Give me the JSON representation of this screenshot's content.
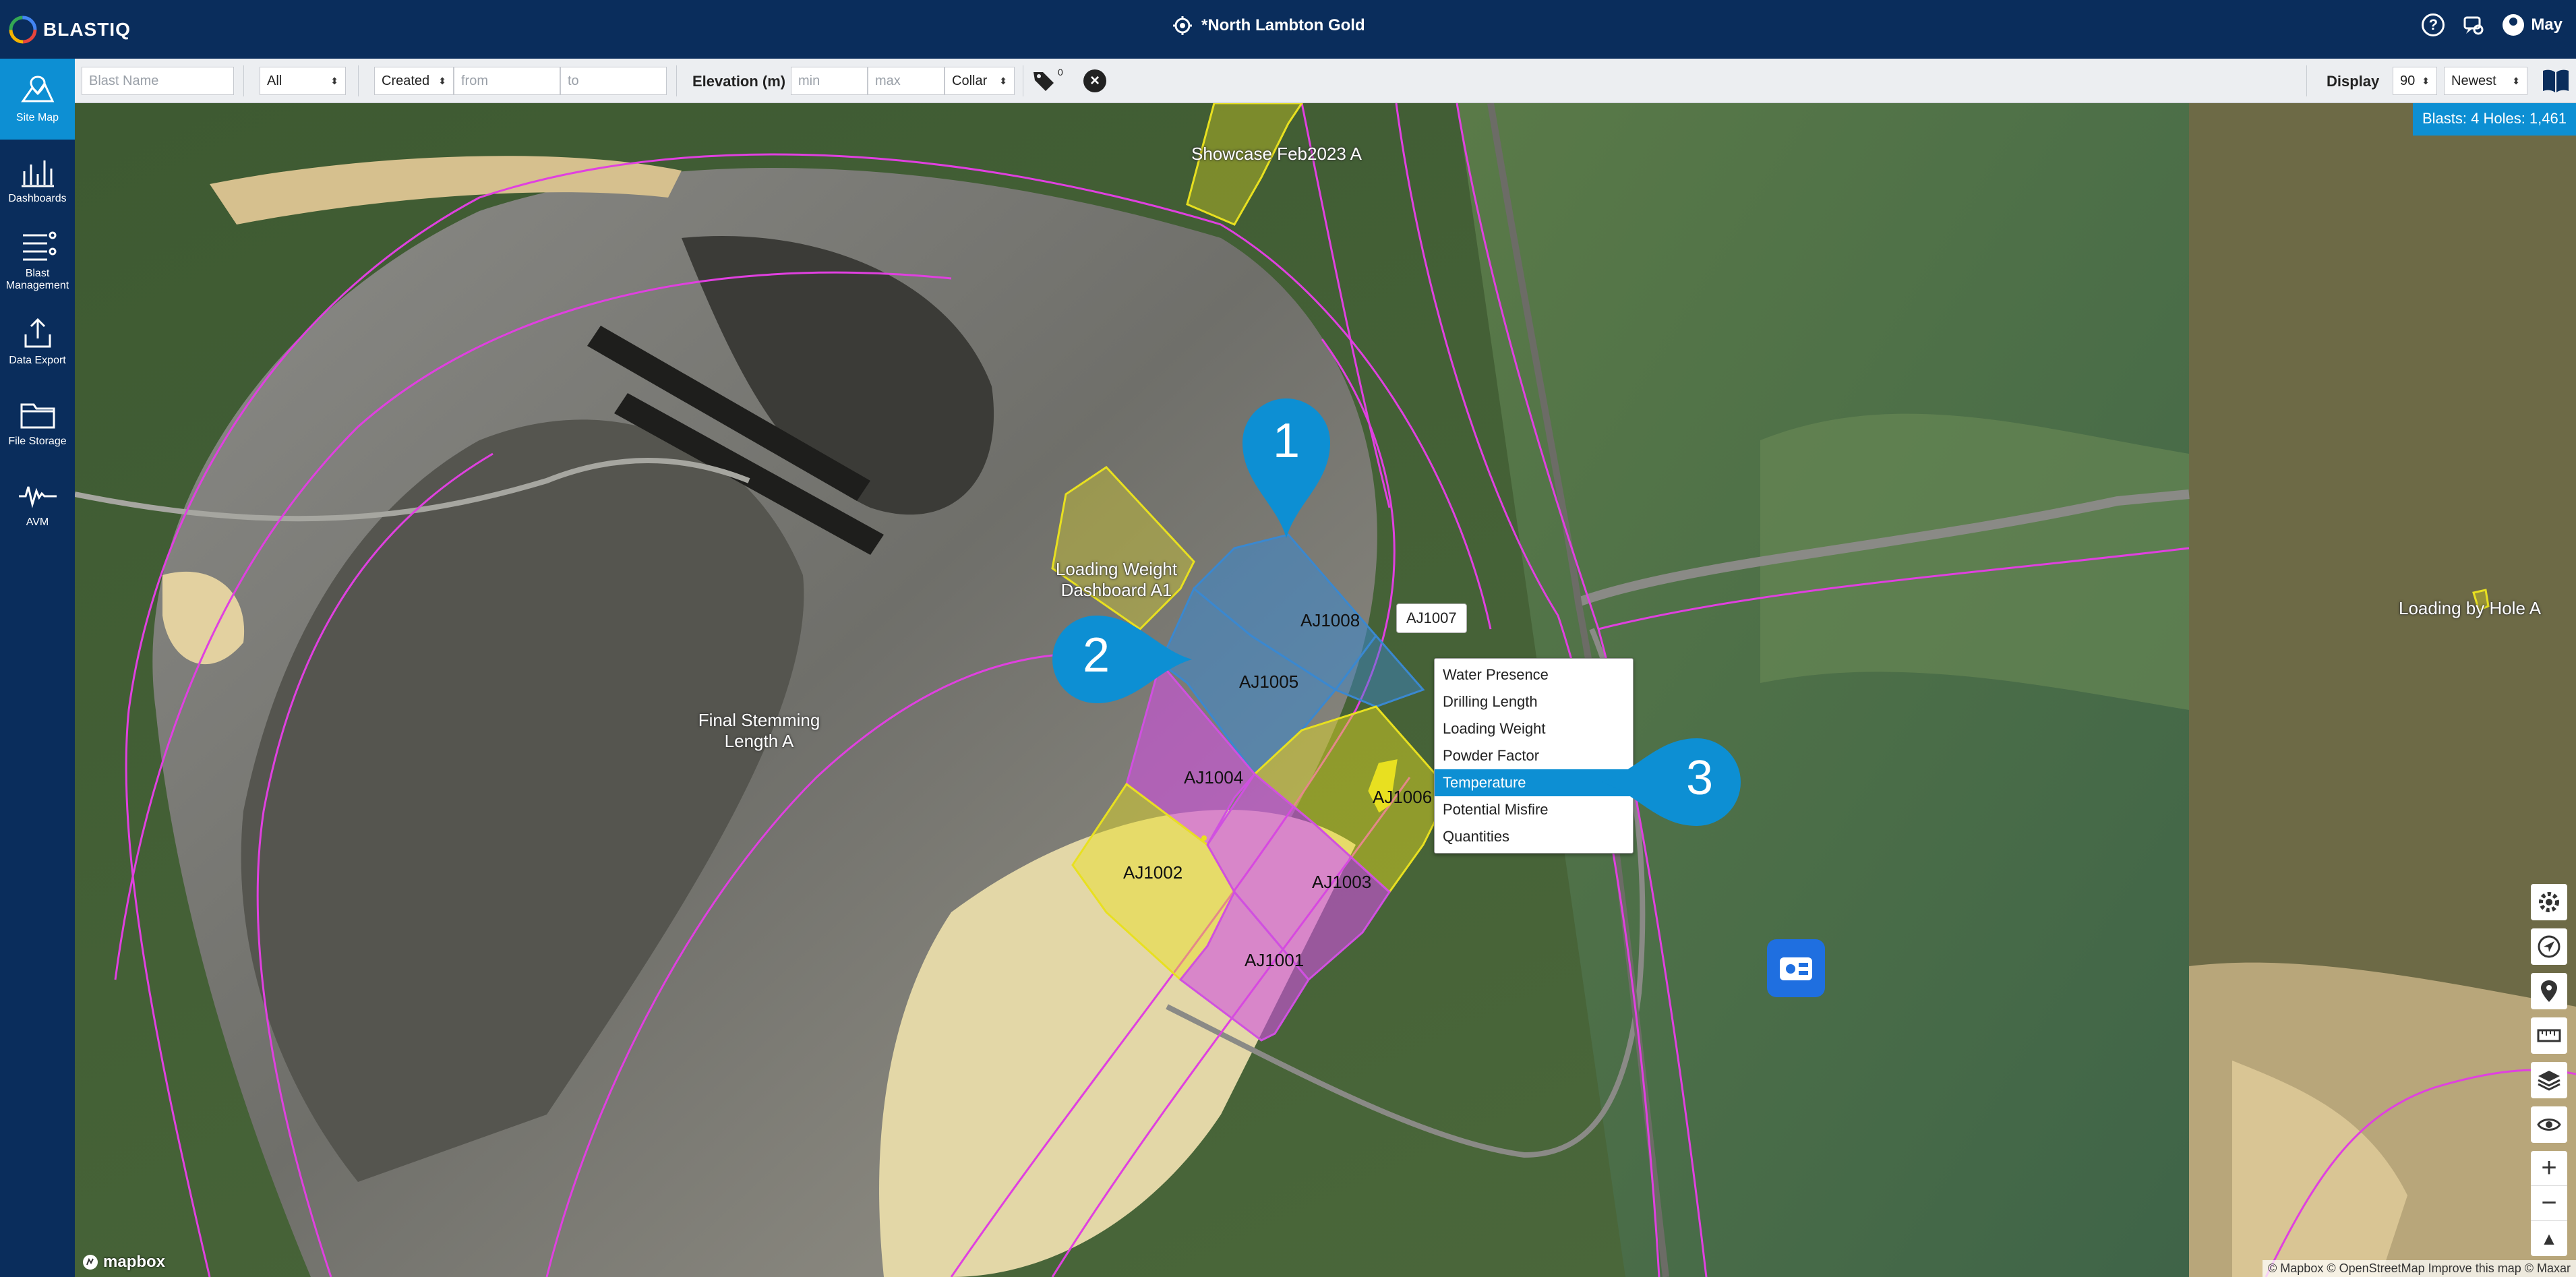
{
  "app": {
    "name": "BLASTIQ",
    "site": "*North Lambton Gold",
    "user": "May"
  },
  "sidebar": {
    "items": [
      {
        "label": "Site Map",
        "icon": "map-icon",
        "active": true
      },
      {
        "label": "Dashboards",
        "icon": "dashboard-icon"
      },
      {
        "label": "Blast Management",
        "icon": "list-icon"
      },
      {
        "label": "Data Export",
        "icon": "export-icon"
      },
      {
        "label": "File Storage",
        "icon": "folder-icon"
      },
      {
        "label": "AVM",
        "icon": "waveform-icon"
      }
    ]
  },
  "filters": {
    "blast_name_placeholder": "Blast Name",
    "type_value": "All",
    "date_field": "Created",
    "from_placeholder": "from",
    "to_placeholder": "to",
    "elevation_label": "Elevation (m)",
    "min_placeholder": "min",
    "max_placeholder": "max",
    "elevation_type": "Collar",
    "tag_count": "0",
    "display_label": "Display",
    "display_count": "90",
    "sort": "Newest"
  },
  "map": {
    "summary": "Blasts: 4 Holes: 1,461",
    "blast_labels": [
      "Showcase Feb2023 A",
      "Loading Weight Dashboard A1",
      "Final Stemming Length A",
      "Loading by Hole A"
    ],
    "holes": [
      "AJ1008",
      "AJ1005",
      "AJ1004",
      "AJ1006",
      "AJ1002",
      "AJ1003",
      "AJ1001"
    ],
    "tooltip": "AJ1007",
    "context_menu": [
      {
        "label": "Water Presence"
      },
      {
        "label": "Drilling Length"
      },
      {
        "label": "Loading Weight"
      },
      {
        "label": "Powder Factor"
      },
      {
        "label": "Temperature",
        "highlighted": true
      },
      {
        "label": "Potential Misfire"
      },
      {
        "label": "Quantities"
      }
    ],
    "markers": [
      "1",
      "2",
      "3"
    ],
    "attribution": "© Mapbox © OpenStreetMap Improve this map © Maxar",
    "mapbox": "mapbox",
    "zoom_in": "+",
    "zoom_out": "−",
    "compass": "▲"
  },
  "colors": {
    "nav": "#0a2d5c",
    "accent": "#0d8fd3",
    "boundary": "#e040e0",
    "yellow": "#e8e020",
    "magenta": "#d050e0",
    "blue": "#3a88d0"
  }
}
